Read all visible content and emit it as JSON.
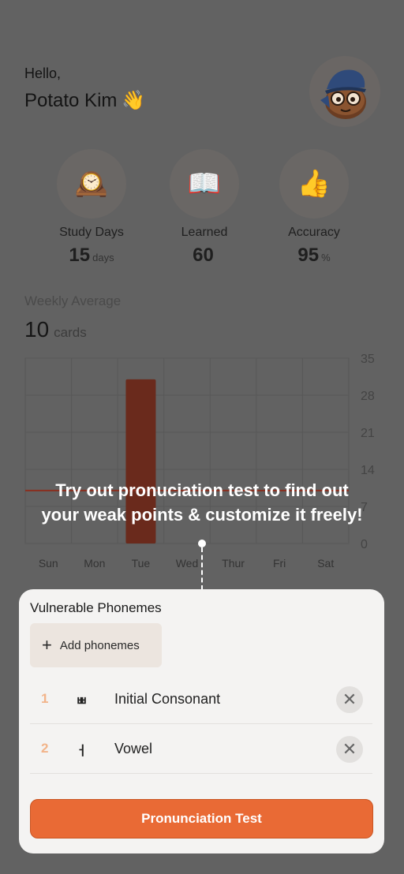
{
  "header": {
    "greeting": "Hello,",
    "name": "Potato Kim",
    "wave_emoji": "👋",
    "avatar_icon": "potato-avatar-icon"
  },
  "stats": [
    {
      "label": "Study Days",
      "value": "15",
      "unit": "days",
      "icon_name": "mantel-clock-icon",
      "glyph": "🕰️"
    },
    {
      "label": "Learned",
      "value": "60",
      "unit": "",
      "icon_name": "open-book-icon",
      "glyph": "📖"
    },
    {
      "label": "Accuracy",
      "value": "95",
      "unit": "%",
      "icon_name": "thumbs-up-icon",
      "glyph": "👍"
    }
  ],
  "weekly": {
    "title": "Weekly Average",
    "value": "10",
    "unit": "cards"
  },
  "chart_data": {
    "type": "bar",
    "categories": [
      "Sun",
      "Mon",
      "Tue",
      "Wed",
      "Thur",
      "Fri",
      "Sat"
    ],
    "values": [
      0,
      0,
      31,
      0,
      0,
      0,
      0
    ],
    "average_line": 10,
    "ylim": [
      0,
      35
    ],
    "yticks": [
      "35",
      "28",
      "21",
      "14",
      "7",
      "0"
    ],
    "grid": true,
    "bar_color": "#6a2a1c",
    "average_color": "#8a2f1f"
  },
  "tooltip": {
    "line1": "Try out pronuciation test to find out",
    "line2": "your weak points & customize it freely!"
  },
  "card": {
    "title": "Vulnerable Phonemes",
    "add_label": "Add phonemes",
    "items": [
      {
        "number": "1",
        "glyph": "ㅃ",
        "label": "Initial Consonant"
      },
      {
        "number": "2",
        "glyph": "ㅓ",
        "label": "Vowel"
      }
    ],
    "test_button": "Pronunciation Test"
  },
  "colors": {
    "accent": "#e96a35",
    "number": "#f2b48a"
  }
}
